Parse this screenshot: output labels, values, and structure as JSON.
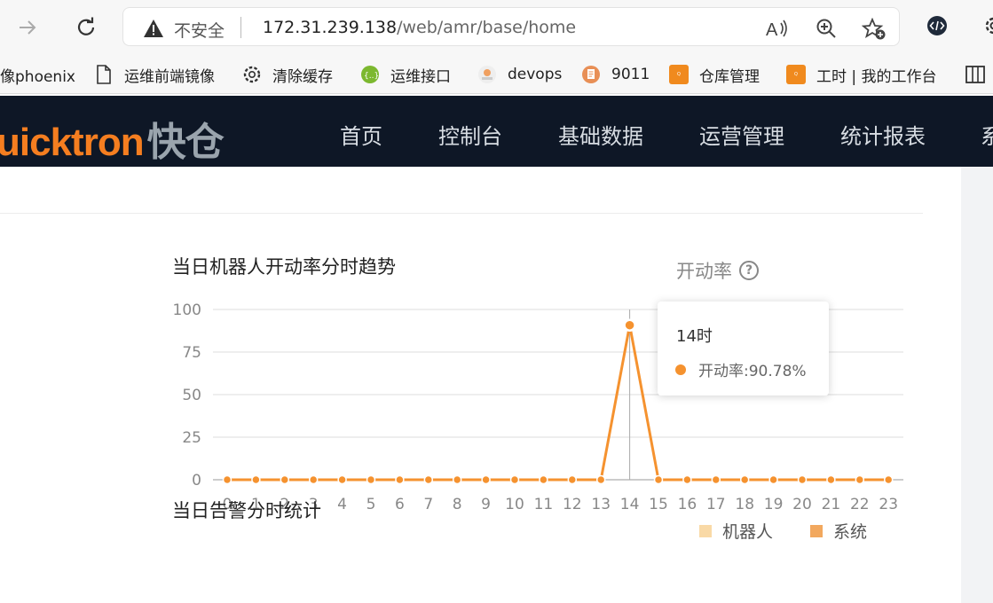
{
  "browser": {
    "insecure_label": "不安全",
    "url_host": "172.31.239.138",
    "url_path": "/web/amr/base/home"
  },
  "bookmarks": [
    {
      "label": "像phoenix",
      "icon": "none"
    },
    {
      "label": "运维前端镜像",
      "icon": "page-icon"
    },
    {
      "label": "清除缓存",
      "icon": "gear-icon"
    },
    {
      "label": "运维接口",
      "icon": "api-icon"
    },
    {
      "label": "devops",
      "icon": "devops-icon"
    },
    {
      "label": "9011",
      "icon": "doc-icon"
    },
    {
      "label": "仓库管理",
      "icon": "quicktron-icon"
    },
    {
      "label": "工时 | 我的工作台",
      "icon": "quicktron-icon"
    }
  ],
  "app": {
    "logo": "uicktron",
    "logo_cn": "快仓",
    "menu": [
      "首页",
      "控制台",
      "基础数据",
      "运营管理",
      "统计报表",
      "系"
    ]
  },
  "chart_section": {
    "title": "当日机器人开动率分时趋势",
    "metric_label": "开动率",
    "alarm_title": "当日告警分时统计"
  },
  "chart_data": {
    "type": "line",
    "x": [
      "0",
      "1",
      "2",
      "3",
      "4",
      "5",
      "6",
      "7",
      "8",
      "9",
      "10",
      "11",
      "12",
      "13",
      "14",
      "15",
      "16",
      "17",
      "18",
      "19",
      "20",
      "21",
      "22",
      "23"
    ],
    "series": [
      {
        "name": "开动率",
        "values": [
          0,
          0,
          0,
          0,
          0,
          0,
          0,
          0,
          0,
          0,
          0,
          0,
          0,
          0,
          90.78,
          0,
          0,
          0,
          0,
          0,
          0,
          0,
          0,
          0
        ]
      }
    ],
    "ylim": [
      0,
      100
    ],
    "yticks": [
      0,
      25,
      50,
      75,
      100
    ],
    "grid": true,
    "color": "#f5922f"
  },
  "tooltip": {
    "title": "14时",
    "row": "开动率:90.78%"
  },
  "legend": [
    {
      "name": "机器人",
      "color": "#f9d9a6"
    },
    {
      "name": "系统",
      "color": "#f2a85e"
    }
  ],
  "colors": {
    "nav_bg": "#0e1726",
    "brand": "#f57e20",
    "line": "#f5922f"
  }
}
